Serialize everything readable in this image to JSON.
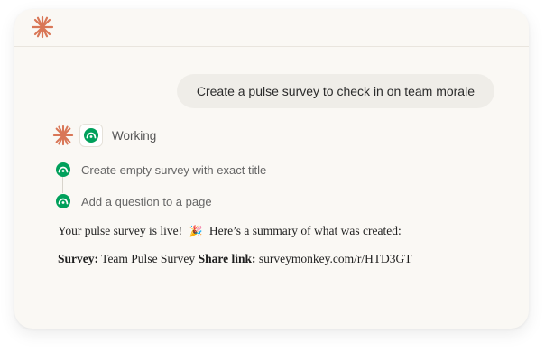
{
  "colors": {
    "accent": "#d97757",
    "surveymonkey_green": "#00a05b",
    "window_bg": "#faf8f4"
  },
  "header": {
    "logo_icon": "claude-asterisk-icon"
  },
  "user_message": {
    "text": "Create a pulse survey to check in on team morale"
  },
  "assistant": {
    "status": "Working",
    "app_icon": "surveymonkey-icon",
    "steps": [
      {
        "label": "Create empty survey with exact title"
      },
      {
        "label": "Add a question to a page"
      }
    ],
    "summary_line": {
      "before": "Your pulse survey is live!",
      "emoji": "🎉",
      "after": "Here’s a summary of what was created:"
    },
    "details": {
      "survey_label": "Survey:",
      "survey_value": "Team Pulse Survey",
      "share_label": "Share link:",
      "share_value": "surveymonkey.com/r/HTD3GT"
    }
  }
}
